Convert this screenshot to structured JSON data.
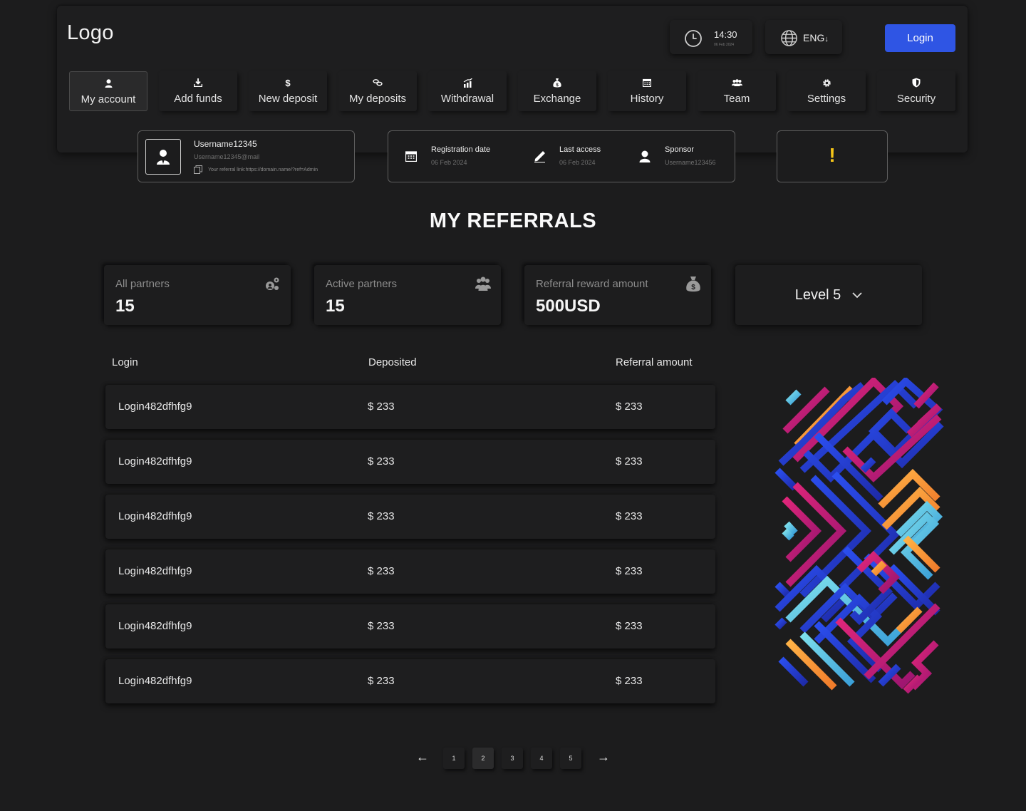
{
  "header": {
    "logo": "Logo",
    "time": "14:30",
    "date": "06 Feb 2024",
    "language": "ENG",
    "login_label": "Login"
  },
  "nav": {
    "items": [
      {
        "label": "My account",
        "icon": "user-icon"
      },
      {
        "label": "Add funds",
        "icon": "download-icon"
      },
      {
        "label": "New deposit",
        "icon": "dollar-icon"
      },
      {
        "label": "My deposits",
        "icon": "coins-icon"
      },
      {
        "label": "Withdrawal",
        "icon": "chart-up-icon"
      },
      {
        "label": "Exchange",
        "icon": "money-bag-icon"
      },
      {
        "label": "History",
        "icon": "calendar-icon"
      },
      {
        "label": "Team",
        "icon": "team-icon"
      },
      {
        "label": "Settings",
        "icon": "gear-icon"
      },
      {
        "label": "Security",
        "icon": "shield-icon"
      }
    ],
    "active": "My account"
  },
  "user": {
    "username": "Username12345",
    "email": "Username12345@mail",
    "referral_link": "Your referral link:https://domain.name/?ref=Admin"
  },
  "info": {
    "registration_label": "Registration date",
    "registration_value": "06 Feb 2024",
    "last_access_label": "Last access",
    "last_access_value": "06 Feb 2024",
    "sponsor_label": "Sponsor",
    "sponsor_value": "Username123456"
  },
  "alert": {
    "symbol": "!"
  },
  "page_title": "MY REFERRALS",
  "stats": {
    "all_partners_label": "All partners",
    "all_partners_value": "15",
    "active_partners_label": "Active partners",
    "active_partners_value": "15",
    "reward_label": "Referral reward amount",
    "reward_value": "500USD"
  },
  "level": {
    "selected": "Level 5"
  },
  "table": {
    "headers": [
      "Login",
      "Deposited",
      "Referral amount"
    ],
    "rows": [
      [
        "Login482dfhfg9",
        "$ 233",
        "$ 233"
      ],
      [
        "Login482dfhfg9",
        "$ 233",
        "$ 233"
      ],
      [
        "Login482dfhfg9",
        "$ 233",
        "$ 233"
      ],
      [
        "Login482dfhfg9",
        "$ 233",
        "$ 233"
      ],
      [
        "Login482dfhfg9",
        "$ 233",
        "$ 233"
      ],
      [
        "Login482dfhfg9",
        "$ 233",
        "$ 233"
      ]
    ]
  },
  "pagination": {
    "prev": "←",
    "next": "→",
    "pages": [
      "1",
      "2",
      "3",
      "4",
      "5"
    ],
    "current": "2"
  },
  "colors": {
    "accent": "#2f55e4",
    "alert": "#f5c518",
    "background": "#1c1c1d"
  }
}
